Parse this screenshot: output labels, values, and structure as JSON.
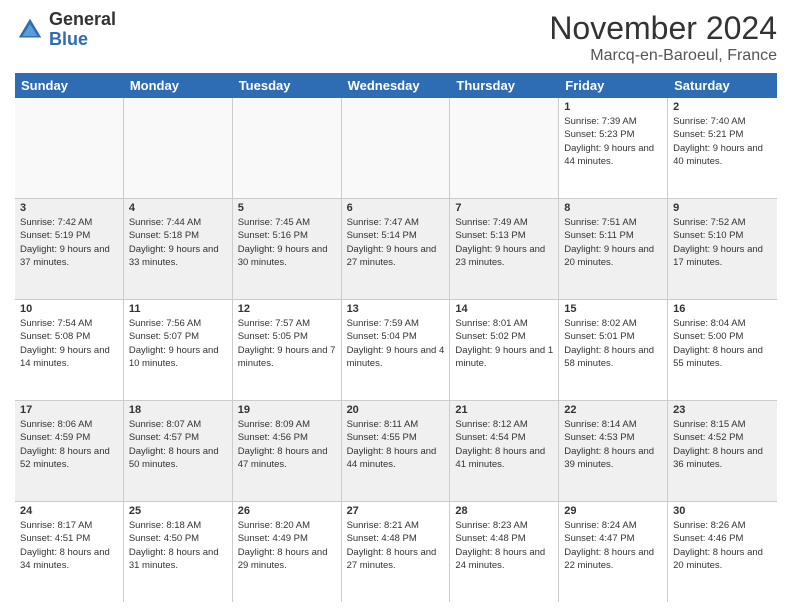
{
  "logo": {
    "general": "General",
    "blue": "Blue"
  },
  "header": {
    "month": "November 2024",
    "location": "Marcq-en-Baroeul, France"
  },
  "weekdays": [
    "Sunday",
    "Monday",
    "Tuesday",
    "Wednesday",
    "Thursday",
    "Friday",
    "Saturday"
  ],
  "rows": [
    [
      {
        "day": "",
        "info": ""
      },
      {
        "day": "",
        "info": ""
      },
      {
        "day": "",
        "info": ""
      },
      {
        "day": "",
        "info": ""
      },
      {
        "day": "",
        "info": ""
      },
      {
        "day": "1",
        "info": "Sunrise: 7:39 AM\nSunset: 5:23 PM\nDaylight: 9 hours and 44 minutes."
      },
      {
        "day": "2",
        "info": "Sunrise: 7:40 AM\nSunset: 5:21 PM\nDaylight: 9 hours and 40 minutes."
      }
    ],
    [
      {
        "day": "3",
        "info": "Sunrise: 7:42 AM\nSunset: 5:19 PM\nDaylight: 9 hours and 37 minutes."
      },
      {
        "day": "4",
        "info": "Sunrise: 7:44 AM\nSunset: 5:18 PM\nDaylight: 9 hours and 33 minutes."
      },
      {
        "day": "5",
        "info": "Sunrise: 7:45 AM\nSunset: 5:16 PM\nDaylight: 9 hours and 30 minutes."
      },
      {
        "day": "6",
        "info": "Sunrise: 7:47 AM\nSunset: 5:14 PM\nDaylight: 9 hours and 27 minutes."
      },
      {
        "day": "7",
        "info": "Sunrise: 7:49 AM\nSunset: 5:13 PM\nDaylight: 9 hours and 23 minutes."
      },
      {
        "day": "8",
        "info": "Sunrise: 7:51 AM\nSunset: 5:11 PM\nDaylight: 9 hours and 20 minutes."
      },
      {
        "day": "9",
        "info": "Sunrise: 7:52 AM\nSunset: 5:10 PM\nDaylight: 9 hours and 17 minutes."
      }
    ],
    [
      {
        "day": "10",
        "info": "Sunrise: 7:54 AM\nSunset: 5:08 PM\nDaylight: 9 hours and 14 minutes."
      },
      {
        "day": "11",
        "info": "Sunrise: 7:56 AM\nSunset: 5:07 PM\nDaylight: 9 hours and 10 minutes."
      },
      {
        "day": "12",
        "info": "Sunrise: 7:57 AM\nSunset: 5:05 PM\nDaylight: 9 hours and 7 minutes."
      },
      {
        "day": "13",
        "info": "Sunrise: 7:59 AM\nSunset: 5:04 PM\nDaylight: 9 hours and 4 minutes."
      },
      {
        "day": "14",
        "info": "Sunrise: 8:01 AM\nSunset: 5:02 PM\nDaylight: 9 hours and 1 minute."
      },
      {
        "day": "15",
        "info": "Sunrise: 8:02 AM\nSunset: 5:01 PM\nDaylight: 8 hours and 58 minutes."
      },
      {
        "day": "16",
        "info": "Sunrise: 8:04 AM\nSunset: 5:00 PM\nDaylight: 8 hours and 55 minutes."
      }
    ],
    [
      {
        "day": "17",
        "info": "Sunrise: 8:06 AM\nSunset: 4:59 PM\nDaylight: 8 hours and 52 minutes."
      },
      {
        "day": "18",
        "info": "Sunrise: 8:07 AM\nSunset: 4:57 PM\nDaylight: 8 hours and 50 minutes."
      },
      {
        "day": "19",
        "info": "Sunrise: 8:09 AM\nSunset: 4:56 PM\nDaylight: 8 hours and 47 minutes."
      },
      {
        "day": "20",
        "info": "Sunrise: 8:11 AM\nSunset: 4:55 PM\nDaylight: 8 hours and 44 minutes."
      },
      {
        "day": "21",
        "info": "Sunrise: 8:12 AM\nSunset: 4:54 PM\nDaylight: 8 hours and 41 minutes."
      },
      {
        "day": "22",
        "info": "Sunrise: 8:14 AM\nSunset: 4:53 PM\nDaylight: 8 hours and 39 minutes."
      },
      {
        "day": "23",
        "info": "Sunrise: 8:15 AM\nSunset: 4:52 PM\nDaylight: 8 hours and 36 minutes."
      }
    ],
    [
      {
        "day": "24",
        "info": "Sunrise: 8:17 AM\nSunset: 4:51 PM\nDaylight: 8 hours and 34 minutes."
      },
      {
        "day": "25",
        "info": "Sunrise: 8:18 AM\nSunset: 4:50 PM\nDaylight: 8 hours and 31 minutes."
      },
      {
        "day": "26",
        "info": "Sunrise: 8:20 AM\nSunset: 4:49 PM\nDaylight: 8 hours and 29 minutes."
      },
      {
        "day": "27",
        "info": "Sunrise: 8:21 AM\nSunset: 4:48 PM\nDaylight: 8 hours and 27 minutes."
      },
      {
        "day": "28",
        "info": "Sunrise: 8:23 AM\nSunset: 4:48 PM\nDaylight: 8 hours and 24 minutes."
      },
      {
        "day": "29",
        "info": "Sunrise: 8:24 AM\nSunset: 4:47 PM\nDaylight: 8 hours and 22 minutes."
      },
      {
        "day": "30",
        "info": "Sunrise: 8:26 AM\nSunset: 4:46 PM\nDaylight: 8 hours and 20 minutes."
      }
    ]
  ]
}
